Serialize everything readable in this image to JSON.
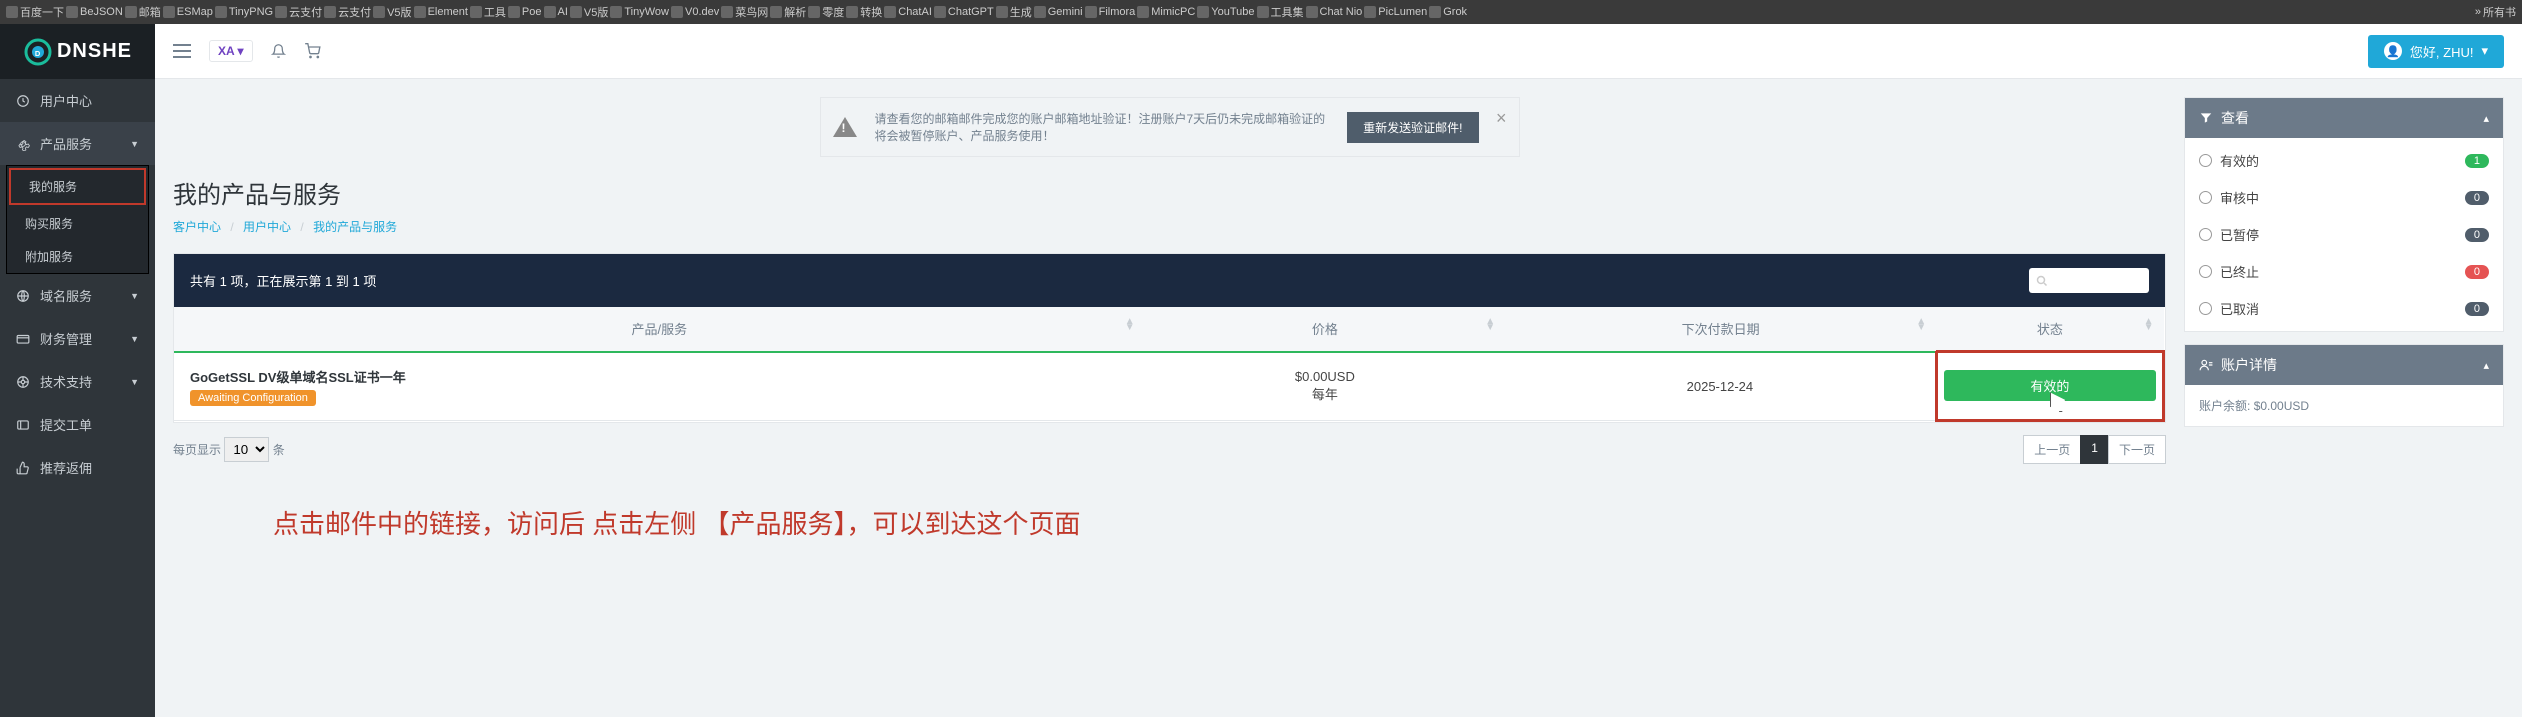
{
  "bookmarks": {
    "items": [
      "百度一下",
      "BeJSON",
      "邮箱",
      "ESMap",
      "TinyPNG",
      "云支付",
      "云支付",
      "V5版",
      "Element",
      "工具",
      "Poe",
      "AI",
      "V5版",
      "TinyWow",
      "V0.dev",
      "菜鸟网",
      "解析",
      "零度",
      "转换",
      "ChatAI",
      "ChatGPT",
      "生成",
      "Gemini",
      "Filmora",
      "MimicPC",
      "YouTube",
      "工具集",
      "Chat Nio",
      "PicLumen",
      "Grok"
    ],
    "overflow": "所有书"
  },
  "brand": {
    "name": "DNSHE"
  },
  "topbar": {
    "lang": "XA ▾",
    "greeting": "您好, ZHU!",
    "greeting_caret": "▾"
  },
  "sidebar": {
    "items": [
      {
        "icon": "dashboard",
        "label": "用户中心"
      },
      {
        "icon": "gear",
        "label": "产品服务",
        "caret": true,
        "sub": [
          {
            "label": "我的服务",
            "active": true
          },
          {
            "label": "购买服务"
          },
          {
            "label": "附加服务"
          }
        ]
      },
      {
        "icon": "globe",
        "label": "域名服务",
        "caret": true
      },
      {
        "icon": "credit",
        "label": "财务管理",
        "caret": true
      },
      {
        "icon": "life",
        "label": "技术支持",
        "caret": true
      },
      {
        "icon": "ticket",
        "label": "提交工单"
      },
      {
        "icon": "thumb",
        "label": "推荐返佣"
      }
    ]
  },
  "alert": {
    "text": "请查看您的邮箱邮件完成您的账户邮箱地址验证！注册账户7天后仍未完成邮箱验证的将会被暂停账户、产品服务使用！",
    "button": "重新发送验证邮件!"
  },
  "page": {
    "title": "我的产品与服务",
    "breadcrumb": {
      "portal": "客户中心",
      "client": "用户中心",
      "current": "我的产品与服务"
    }
  },
  "table": {
    "summary": "共有 1 项，正在展示第 1 到 1 项",
    "search_placeholder": "",
    "headers": {
      "product": "产品/服务",
      "price": "价格",
      "next_due": "下次付款日期",
      "status": "状态"
    },
    "rows": [
      {
        "name": "GoGetSSL DV级单域名SSL证书一年",
        "badge": "Awaiting Configuration",
        "price": "$0.00USD",
        "cycle": "每年",
        "next_due": "2025-12-24",
        "status": "有效的"
      }
    ]
  },
  "pager": {
    "per_page_label": "每页显示",
    "per_page_value": "10",
    "per_page_suffix": "条",
    "prev": "上一页",
    "page": "1",
    "next": "下一页"
  },
  "instruction": "点击邮件中的链接，访问后 点击左侧 【产品服务】，可以到达这个页面",
  "filter": {
    "title": "查看",
    "items": [
      {
        "label": "有效的",
        "count": "1",
        "cls": "green"
      },
      {
        "label": "审核中",
        "count": "0",
        "cls": ""
      },
      {
        "label": "已暂停",
        "count": "0",
        "cls": ""
      },
      {
        "label": "已终止",
        "count": "0",
        "cls": "red"
      },
      {
        "label": "已取消",
        "count": "0",
        "cls": ""
      }
    ]
  },
  "account": {
    "title": "账户详情",
    "balance_label": "账户余额:",
    "balance_value": "$0.00USD"
  }
}
